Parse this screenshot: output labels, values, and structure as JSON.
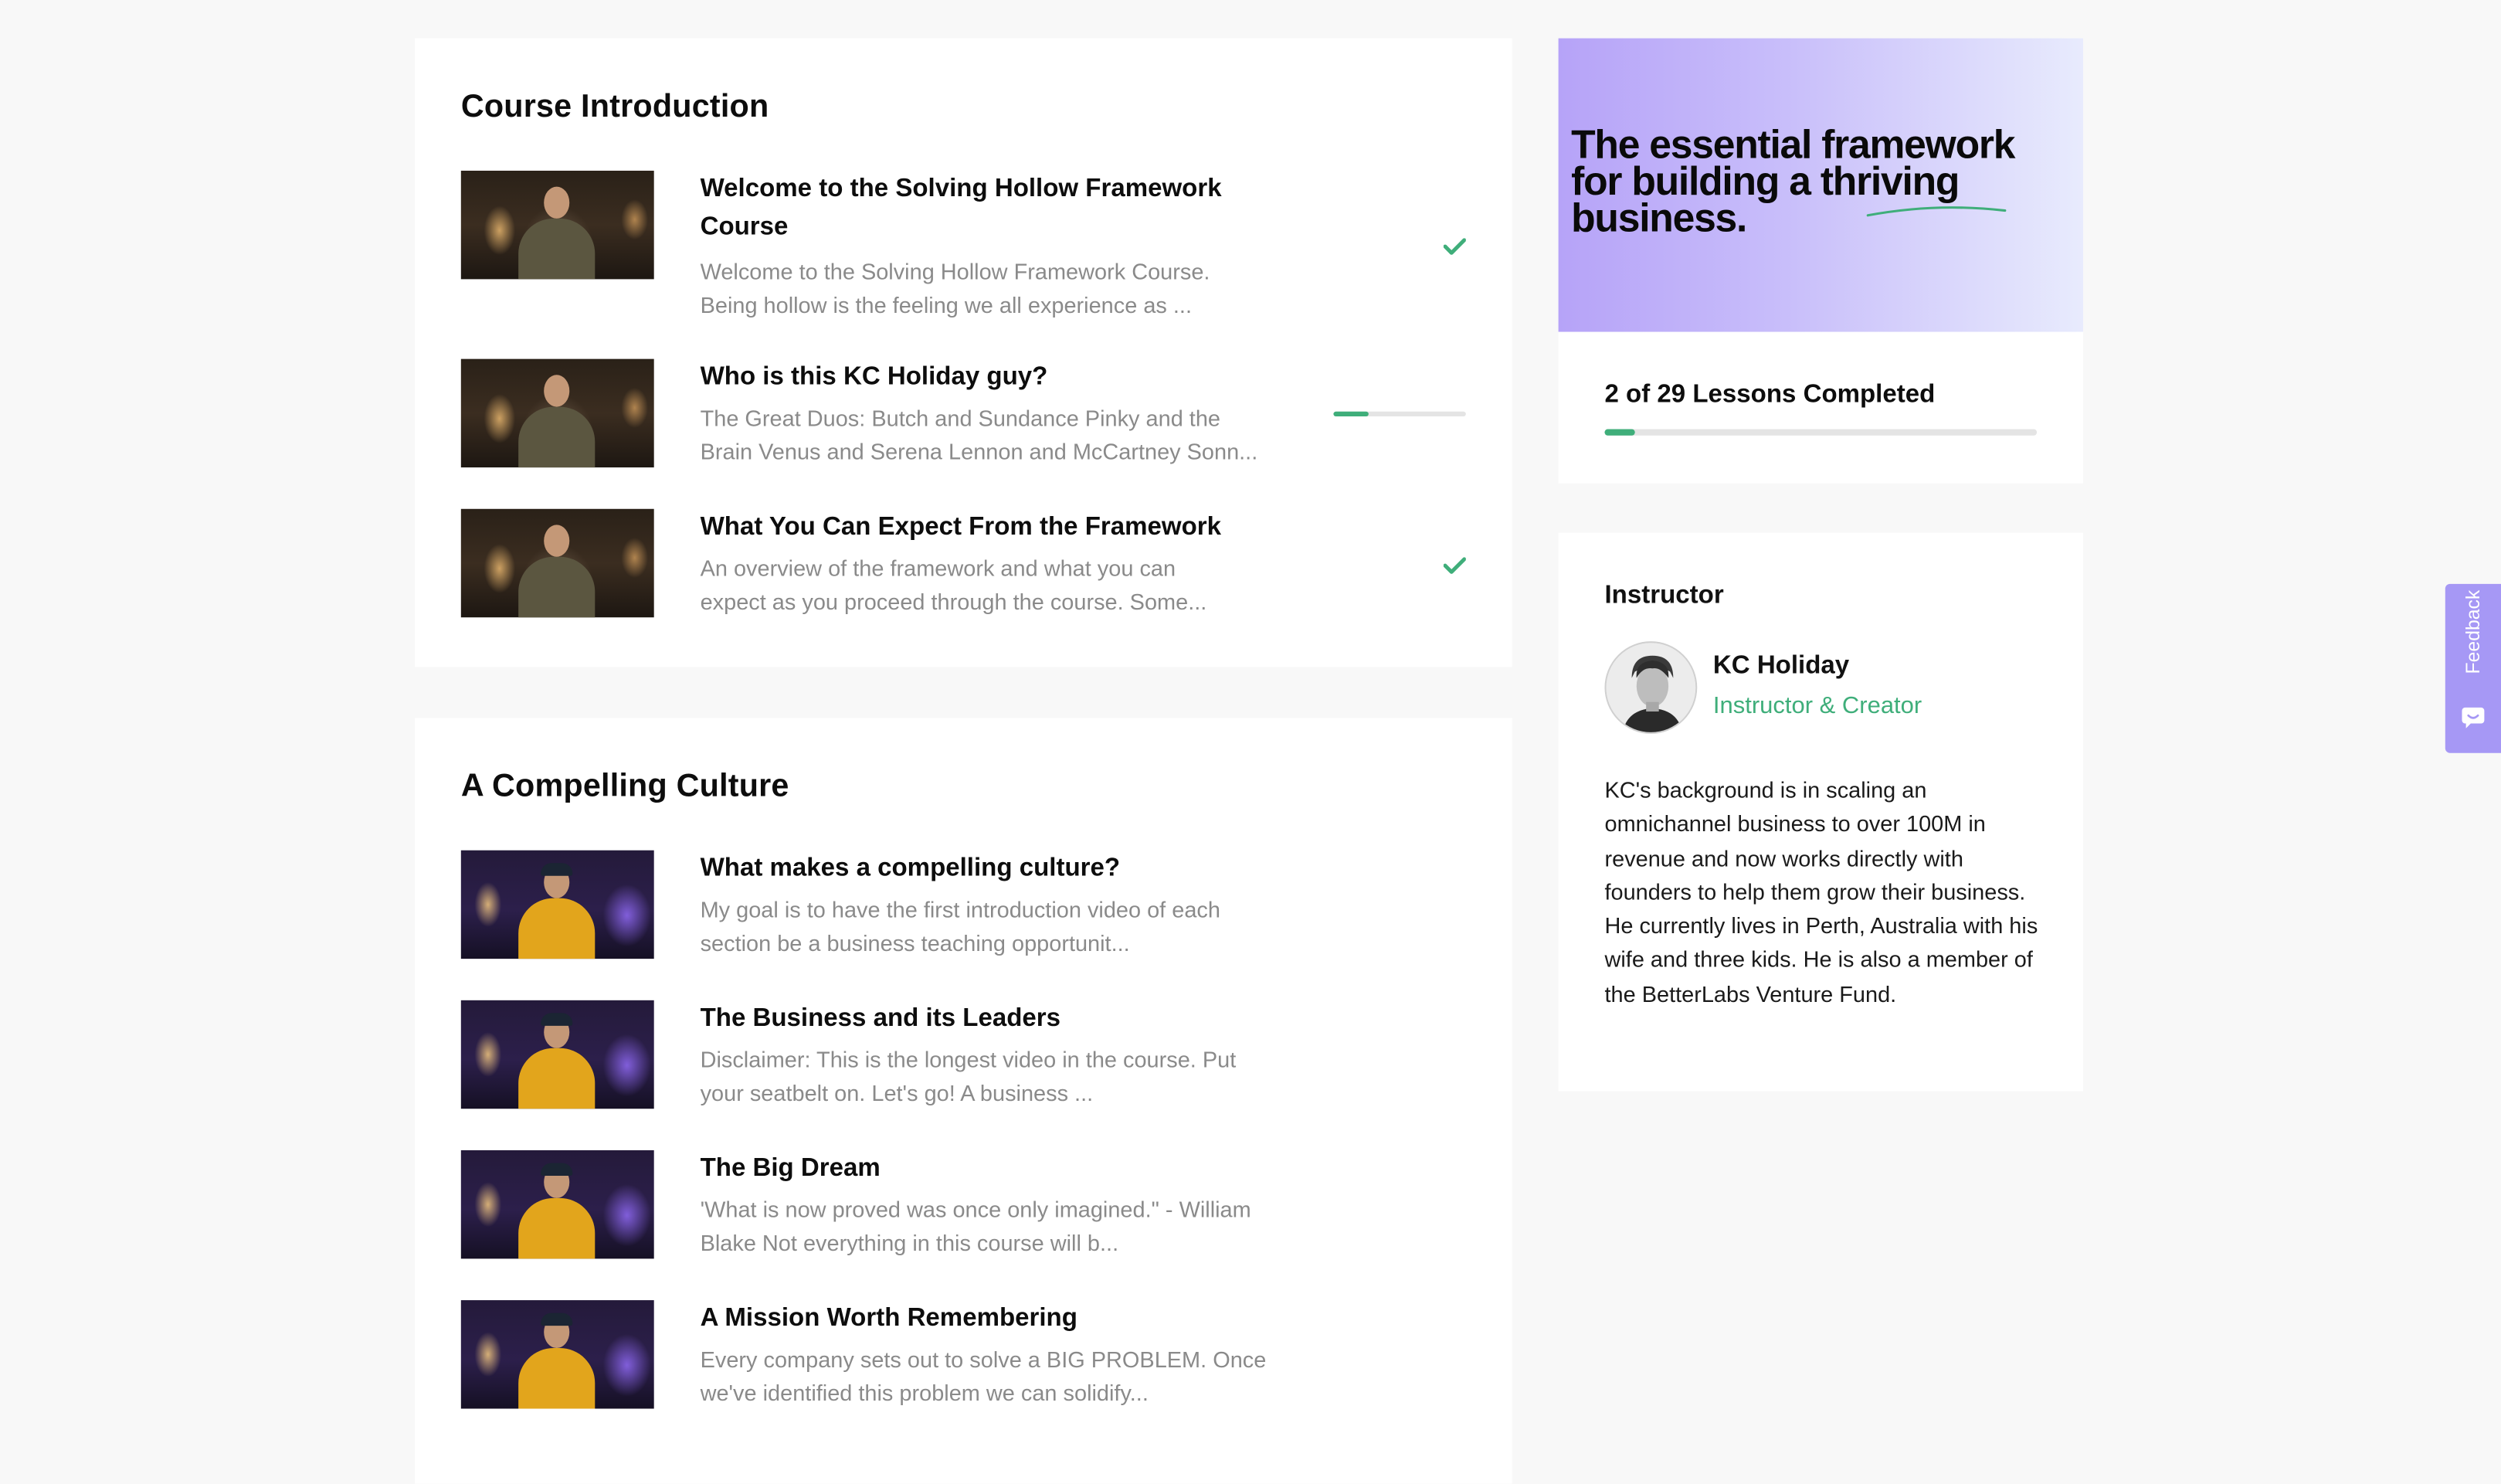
{
  "sections": [
    {
      "title": "Course Introduction",
      "lessons": [
        {
          "title": "Welcome to the Solving Hollow Framework\nCourse",
          "description": "Welcome to the Solving Hollow Framework Course.\nBeing hollow is the feeling we all experience as ...",
          "status": "completed",
          "thumbnail_style": "warm"
        },
        {
          "title": "Who is this KC Holiday guy?",
          "description": "The Great Duos: Butch and Sundance Pinky and the\nBrain Venus and Serena Lennon and McCartney Sonn...",
          "status": "in-progress",
          "progress_fraction": 0.27,
          "thumbnail_style": "warm"
        },
        {
          "title": "What You Can Expect From the Framework",
          "description": "An overview of the framework and what you can\nexpect as you proceed through the course. Some...",
          "status": "completed",
          "thumbnail_style": "warm"
        }
      ]
    },
    {
      "title": "A Compelling Culture",
      "lessons": [
        {
          "title": "What makes a compelling culture?",
          "description": "My goal is to have the first introduction video of each\nsection be a business teaching opportunit...",
          "status": "not-started",
          "thumbnail_style": "purple"
        },
        {
          "title": "The Business and its Leaders",
          "description": "Disclaimer: This is the longest video in the course. Put\nyour seatbelt on. Let's go! A business ...",
          "status": "not-started",
          "thumbnail_style": "purple"
        },
        {
          "title": "The Big Dream",
          "description": "'What is now proved was once only imagined.\" - William\nBlake Not everything in this course will b...",
          "status": "not-started",
          "thumbnail_style": "purple"
        },
        {
          "title": "A Mission Worth Remembering",
          "description": "Every company sets out to solve a BIG PROBLEM. Once\nwe've identified this problem we can solidify...",
          "status": "not-started",
          "thumbnail_style": "purple"
        }
      ]
    }
  ],
  "banner": {
    "text": "The essential framework\nfor building a thriving\nbusiness."
  },
  "progress": {
    "label": "2 of 29 Lessons Completed",
    "completed": 2,
    "total": 29
  },
  "instructor": {
    "heading": "Instructor",
    "name": "KC Holiday",
    "role": "Instructor & Creator",
    "bio": "KC's background is in scaling an omnichannel business to over 100M in revenue and now works directly with founders to help them grow their business. He currently lives in Perth, Australia with his wife and three kids. He is also a member of the BetterLabs Venture Fund."
  },
  "feedback": {
    "label": "Feedback",
    "icon": "chat-smile-icon"
  },
  "colors": {
    "accent_green": "#3fae7a",
    "feedback_purple": "#a698f5",
    "banner_gradient_start": "#b6a3f8",
    "banner_gradient_end": "#e8ebfd",
    "progress_track": "#e4e4e4"
  },
  "icons": {
    "completed": "check-icon",
    "lesson_thumbnail": "video-thumbnail"
  }
}
